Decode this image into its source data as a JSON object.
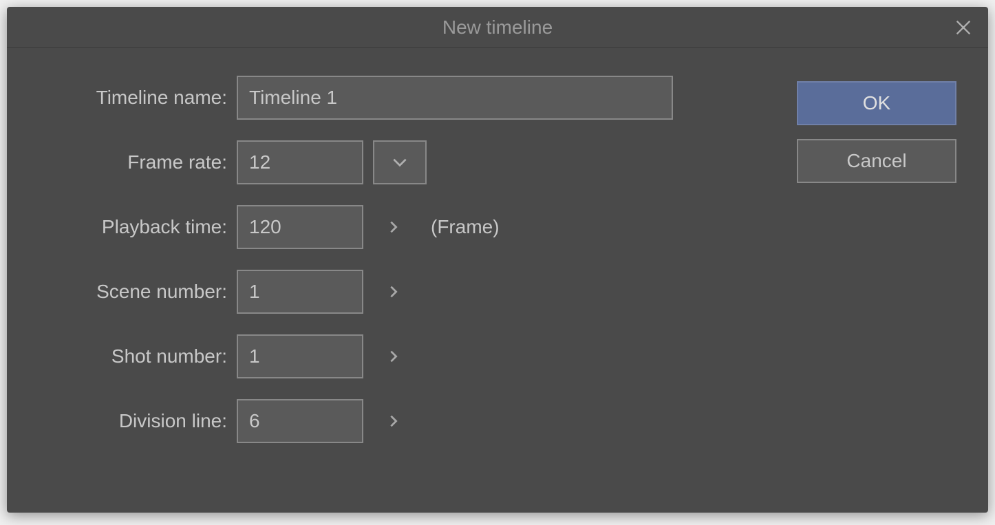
{
  "dialog": {
    "title": "New timeline"
  },
  "fields": {
    "timeline_name": {
      "label": "Timeline name:",
      "value": "Timeline 1"
    },
    "frame_rate": {
      "label": "Frame rate:",
      "value": "12"
    },
    "playback_time": {
      "label": "Playback time:",
      "value": "120",
      "suffix": "(Frame)"
    },
    "scene_number": {
      "label": "Scene number:",
      "value": "1"
    },
    "shot_number": {
      "label": "Shot number:",
      "value": "1"
    },
    "division_line": {
      "label": "Division line:",
      "value": "6"
    }
  },
  "buttons": {
    "ok": "OK",
    "cancel": "Cancel"
  }
}
